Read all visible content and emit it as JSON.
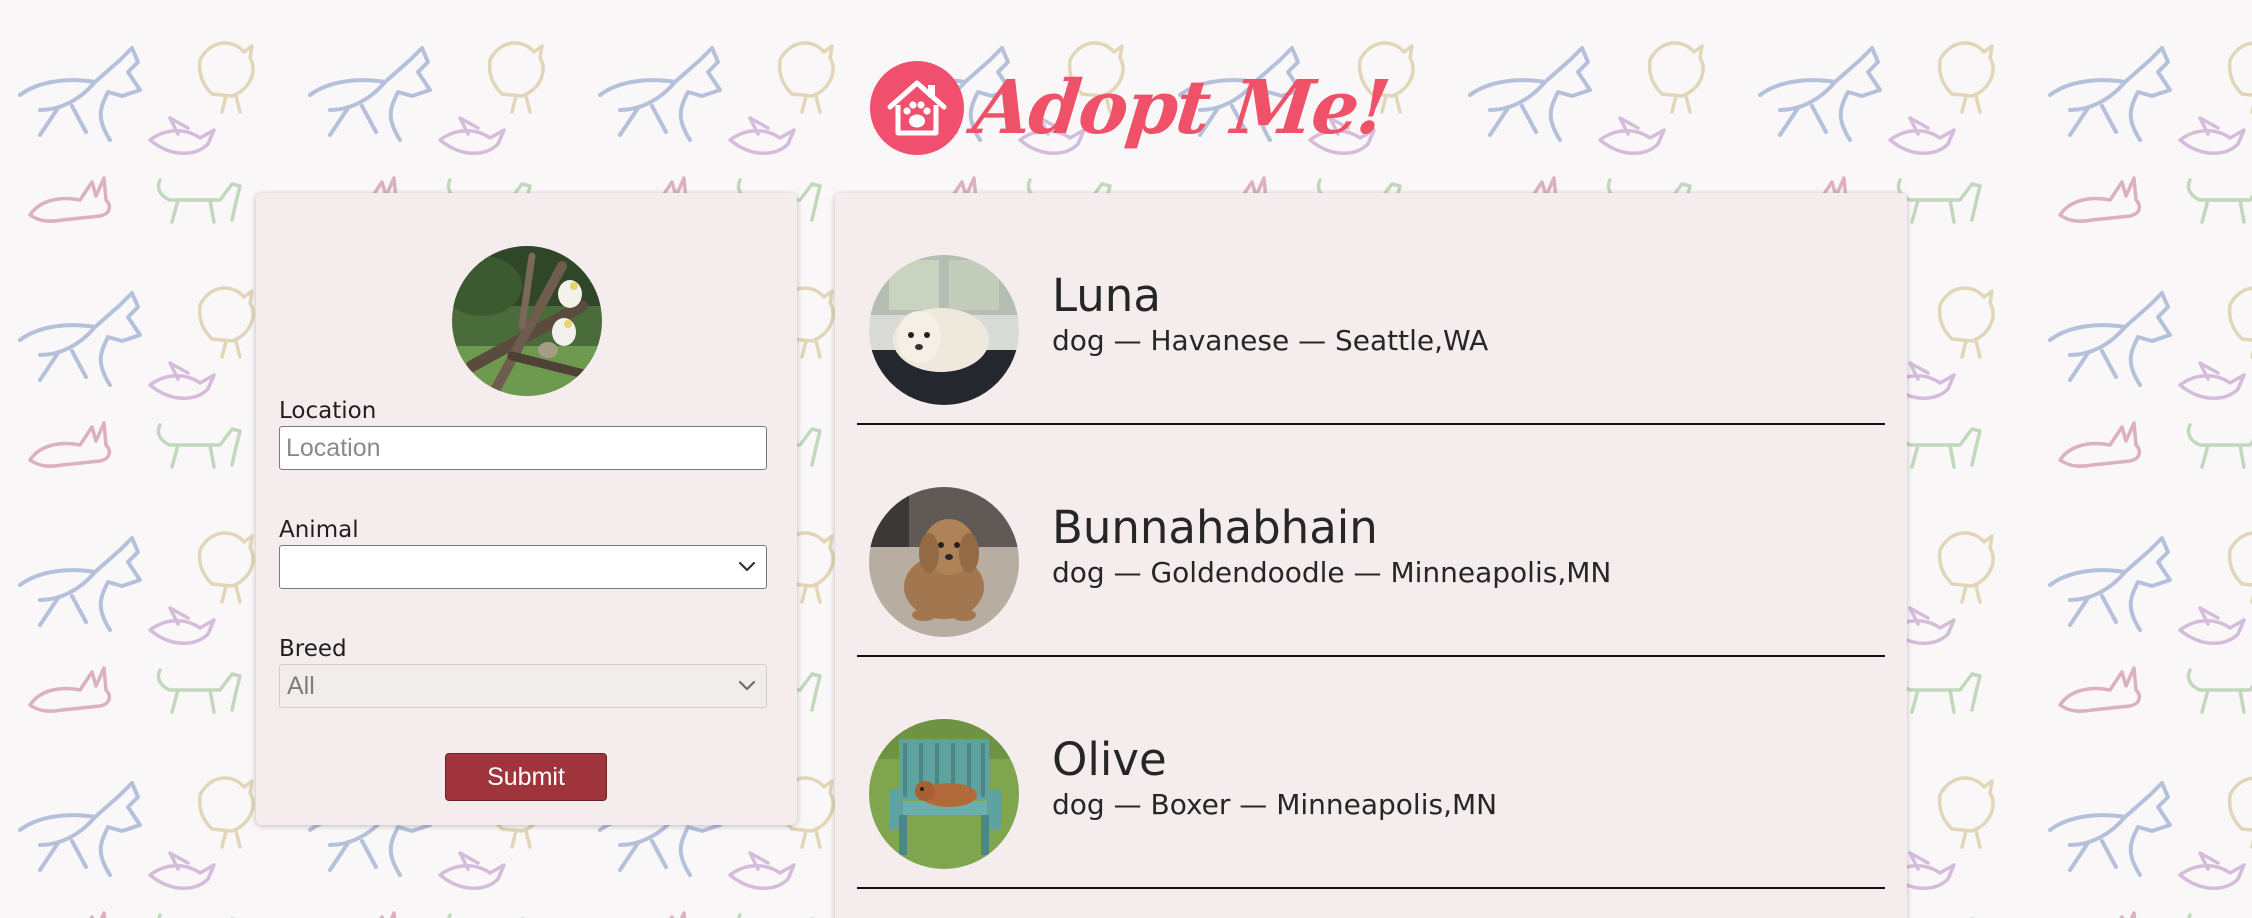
{
  "header": {
    "logo_text": "Adopt Me!",
    "logo_icon": "house-paw-icon",
    "brand_color": "#ef5168"
  },
  "search": {
    "avatar_icon": "pet-photo",
    "location": {
      "label": "Location",
      "value": "",
      "placeholder": "Location"
    },
    "animal": {
      "label": "Animal",
      "selected": ""
    },
    "breed": {
      "label": "Breed",
      "selected": "All"
    },
    "submit_label": "Submit"
  },
  "results": [
    {
      "name": "Luna",
      "description": "dog — Havanese — Seattle,WA"
    },
    {
      "name": "Bunnahabhain",
      "description": "dog — Goldendoodle — Minneapolis,MN"
    },
    {
      "name": "Olive",
      "description": "dog — Boxer — Minneapolis,MN"
    }
  ],
  "colors": {
    "card_background": "#f5ecee",
    "submit_background": "#a0343c"
  }
}
